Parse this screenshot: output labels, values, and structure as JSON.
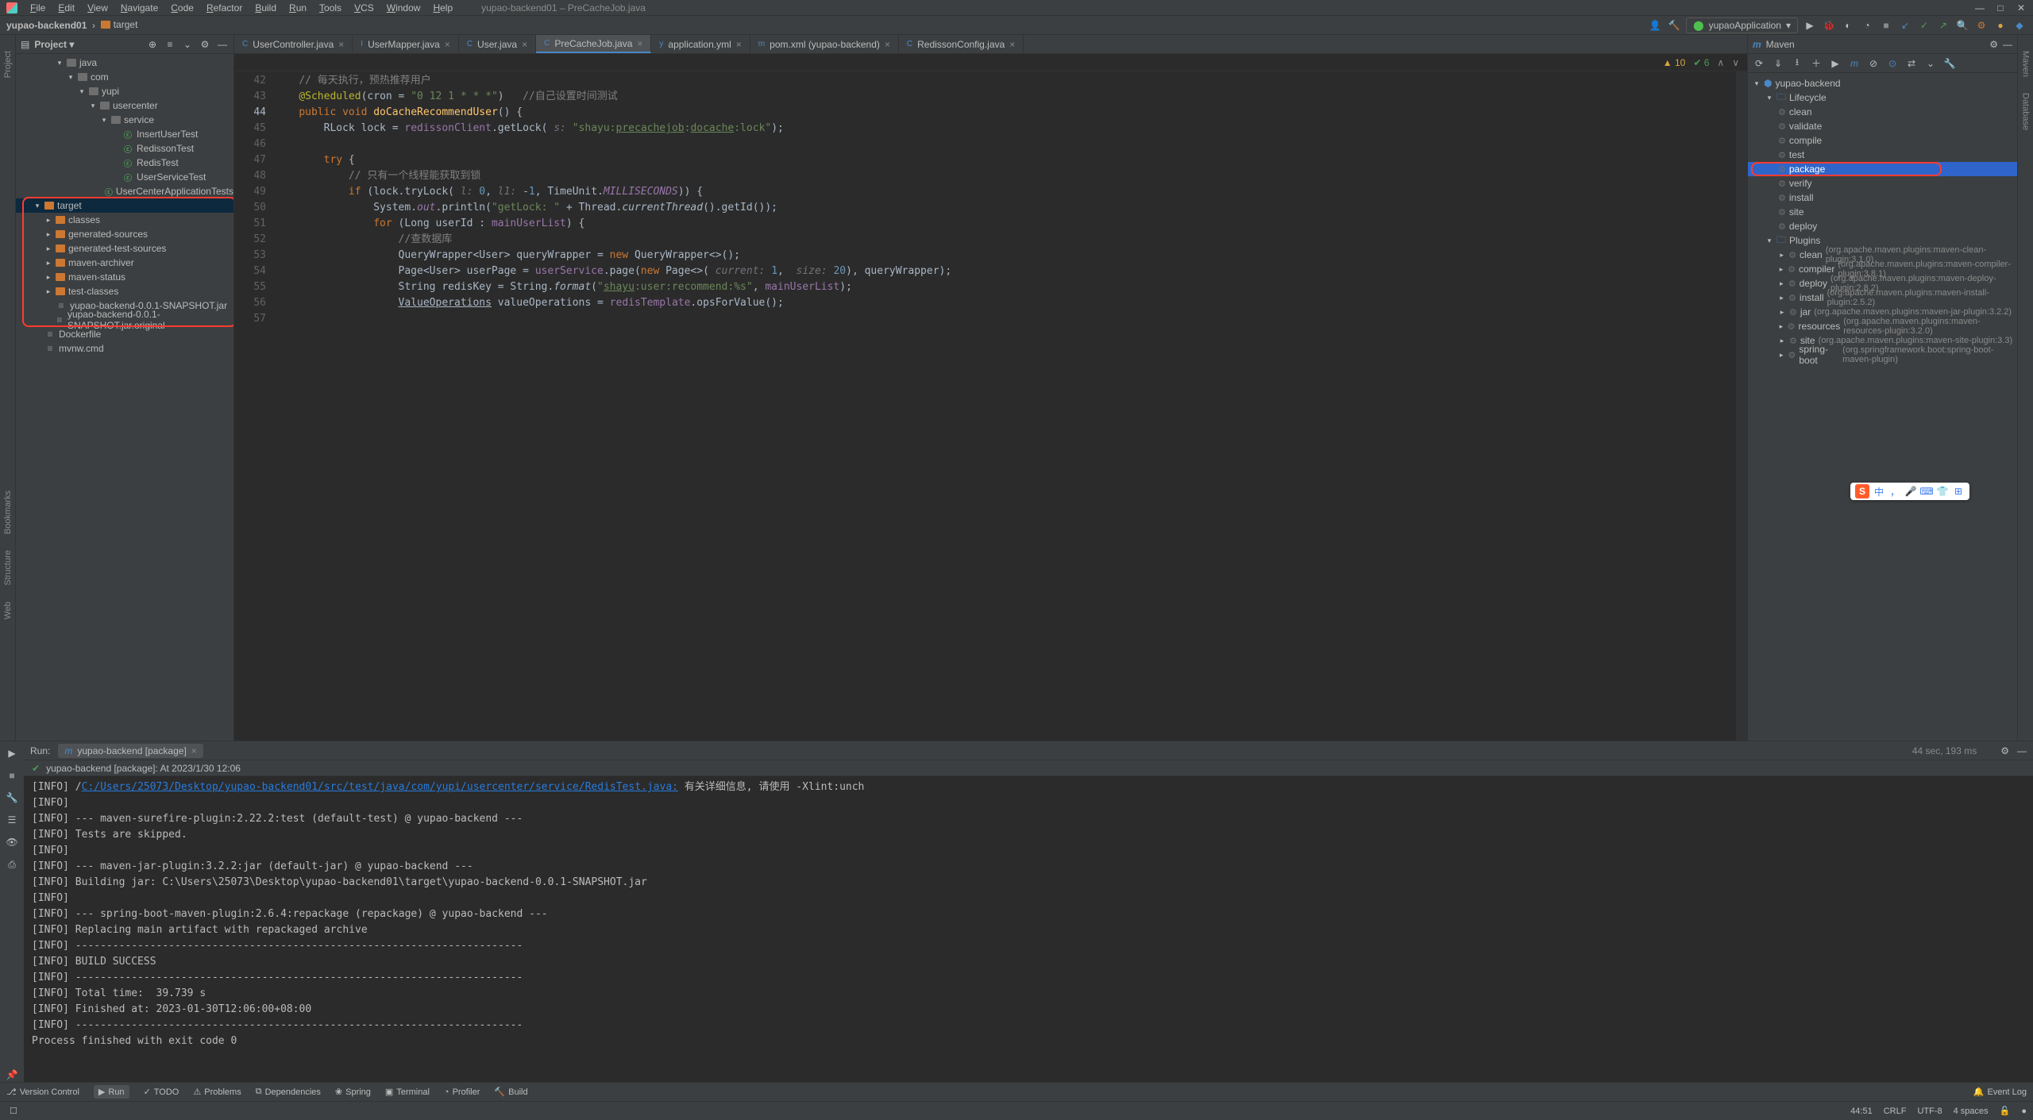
{
  "window": {
    "title": "yupao-backend01 – PreCacheJob.java"
  },
  "menu": [
    "File",
    "Edit",
    "View",
    "Navigate",
    "Code",
    "Refactor",
    "Build",
    "Run",
    "Tools",
    "VCS",
    "Window",
    "Help"
  ],
  "breadcrumb": {
    "root": "yupao-backend01",
    "path": "target"
  },
  "run_config": "yupaoApplication",
  "project_panel": {
    "title": "Project",
    "tree": [
      {
        "indent": 3,
        "chev": "▾",
        "icon": "folder",
        "label": "java"
      },
      {
        "indent": 4,
        "chev": "▾",
        "icon": "folder",
        "label": "com"
      },
      {
        "indent": 5,
        "chev": "▾",
        "icon": "folder",
        "label": "yupi"
      },
      {
        "indent": 6,
        "chev": "▾",
        "icon": "folder",
        "label": "usercenter"
      },
      {
        "indent": 7,
        "chev": "▾",
        "icon": "folder",
        "label": "service"
      },
      {
        "indent": 8,
        "chev": "",
        "icon": "cls",
        "label": "InsertUserTest"
      },
      {
        "indent": 8,
        "chev": "",
        "icon": "cls",
        "label": "RedissonTest"
      },
      {
        "indent": 8,
        "chev": "",
        "icon": "cls",
        "label": "RedisTest"
      },
      {
        "indent": 8,
        "chev": "",
        "icon": "cls",
        "label": "UserServiceTest"
      },
      {
        "indent": 7,
        "chev": "",
        "icon": "cls",
        "label": "UserCenterApplicationTests"
      },
      {
        "indent": 1,
        "chev": "▾",
        "icon": "folder-o",
        "label": "target",
        "selected": true
      },
      {
        "indent": 2,
        "chev": "▸",
        "icon": "folder-o",
        "label": "classes"
      },
      {
        "indent": 2,
        "chev": "▸",
        "icon": "folder-o",
        "label": "generated-sources"
      },
      {
        "indent": 2,
        "chev": "▸",
        "icon": "folder-o",
        "label": "generated-test-sources"
      },
      {
        "indent": 2,
        "chev": "▸",
        "icon": "folder-o",
        "label": "maven-archiver"
      },
      {
        "indent": 2,
        "chev": "▸",
        "icon": "folder-o",
        "label": "maven-status"
      },
      {
        "indent": 2,
        "chev": "▸",
        "icon": "folder-o",
        "label": "test-classes"
      },
      {
        "indent": 2,
        "chev": "",
        "icon": "file",
        "label": "yupao-backend-0.0.1-SNAPSHOT.jar"
      },
      {
        "indent": 2,
        "chev": "",
        "icon": "file",
        "label": "yupao-backend-0.0.1-SNAPSHOT.jar.original"
      },
      {
        "indent": 1,
        "chev": "",
        "icon": "file",
        "label": "Dockerfile"
      },
      {
        "indent": 1,
        "chev": "",
        "icon": "file",
        "label": "mvnw.cmd"
      }
    ]
  },
  "editor": {
    "tabs": [
      {
        "label": "UserController.java",
        "active": false,
        "icon": "C"
      },
      {
        "label": "UserMapper.java",
        "active": false,
        "icon": "I"
      },
      {
        "label": "User.java",
        "active": false,
        "icon": "C"
      },
      {
        "label": "PreCacheJob.java",
        "active": true,
        "icon": "C"
      },
      {
        "label": "application.yml",
        "active": false,
        "icon": "y"
      },
      {
        "label": "pom.xml (yupao-backend)",
        "active": false,
        "icon": "m"
      },
      {
        "label": "RedissonConfig.java",
        "active": false,
        "icon": "C"
      }
    ],
    "inspections": {
      "warn": "10",
      "ok": "6"
    },
    "lines": [
      42,
      43,
      44,
      45,
      46,
      47,
      48,
      49,
      50,
      51,
      52,
      53,
      54,
      55,
      56,
      57
    ],
    "curline": 44
  },
  "maven": {
    "title": "Maven",
    "root": "yupao-backend",
    "lifecycle_label": "Lifecycle",
    "lifecycle": [
      "clean",
      "validate",
      "compile",
      "test",
      "package",
      "verify",
      "install",
      "site",
      "deploy"
    ],
    "lifecycle_selected": "package",
    "plugins_label": "Plugins",
    "plugins": [
      {
        "name": "clean",
        "desc": "(org.apache.maven.plugins:maven-clean-plugin:3.1.0)"
      },
      {
        "name": "compiler",
        "desc": "(org.apache.maven.plugins:maven-compiler-plugin:3.8.1)"
      },
      {
        "name": "deploy",
        "desc": "(org.apache.maven.plugins:maven-deploy-plugin:2.8.2)"
      },
      {
        "name": "install",
        "desc": "(org.apache.maven.plugins:maven-install-plugin:2.5.2)"
      },
      {
        "name": "jar",
        "desc": "(org.apache.maven.plugins:maven-jar-plugin:3.2.2)"
      },
      {
        "name": "resources",
        "desc": "(org.apache.maven.plugins:maven-resources-plugin:3.2.0)"
      },
      {
        "name": "site",
        "desc": "(org.apache.maven.plugins:maven-site-plugin:3.3)"
      },
      {
        "name": "spring-boot",
        "desc": "(org.springframework.boot:spring-boot-maven-plugin)"
      }
    ]
  },
  "run": {
    "tab_label": "yupao-backend [package]",
    "status_line": "yupao-backend [package]: At 2023/1/30 12:06",
    "elapsed": "44 sec, 193 ms",
    "out": [
      {
        "pre": "[INFO] /",
        "link": "C:/Users/25073/Desktop/yupao-backend01/src/test/java/com/yupi/usercenter/service/RedisTest.java:",
        "post": " 有关详细信息, 请使用 -Xlint:unch"
      },
      {
        "pre": "[INFO]"
      },
      {
        "pre": "[INFO] --- maven-surefire-plugin:2.22.2:test (default-test) @ yupao-backend ---"
      },
      {
        "pre": "[INFO] Tests are skipped."
      },
      {
        "pre": "[INFO]"
      },
      {
        "pre": "[INFO] --- maven-jar-plugin:3.2.2:jar (default-jar) @ yupao-backend ---"
      },
      {
        "pre": "[INFO] Building jar: C:\\Users\\25073\\Desktop\\yupao-backend01\\target\\yupao-backend-0.0.1-SNAPSHOT.jar"
      },
      {
        "pre": "[INFO]"
      },
      {
        "pre": "[INFO] --- spring-boot-maven-plugin:2.6.4:repackage (repackage) @ yupao-backend ---"
      },
      {
        "pre": "[INFO] Replacing main artifact with repackaged archive"
      },
      {
        "pre": "[INFO] ------------------------------------------------------------------------"
      },
      {
        "pre": "[INFO] BUILD SUCCESS"
      },
      {
        "pre": "[INFO] ------------------------------------------------------------------------"
      },
      {
        "pre": "[INFO] Total time:  39.739 s"
      },
      {
        "pre": "[INFO] Finished at: 2023-01-30T12:06:00+08:00"
      },
      {
        "pre": "[INFO] ------------------------------------------------------------------------"
      },
      {
        "pre": ""
      },
      {
        "pre": "Process finished with exit code 0"
      }
    ]
  },
  "bottom_tabs": [
    "Version Control",
    "Run",
    "TODO",
    "Problems",
    "Dependencies",
    "Spring",
    "Terminal",
    "Profiler",
    "Build"
  ],
  "bottom_right": "Event Log",
  "status": {
    "pos": "44:51",
    "lineend": "CRLF",
    "encoding": "UTF-8",
    "indent": "4 spaces"
  },
  "run_label": "Run:",
  "left_tabs": {
    "project": "Project",
    "bookmarks": "Bookmarks",
    "structure": "Structure",
    "web": "Web"
  },
  "right_tabs": {
    "maven": "Maven",
    "database": "Database"
  },
  "ime": "中"
}
